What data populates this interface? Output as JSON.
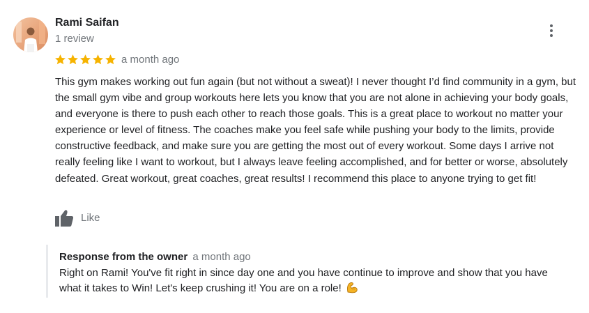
{
  "reviewer": {
    "name": "Rami Saifan",
    "review_count": "1 review",
    "avatar_icon": "profile-photo"
  },
  "review": {
    "rating": 5,
    "rating_max": 5,
    "star_color": "#f6b300",
    "date": "a month ago",
    "text": "This gym makes working out fun again (but not without a sweat)! I never thought I’d find community in a gym, but the small gym vibe and group workouts here lets you know that you are not alone in achieving your body goals, and everyone is there to push each other to reach those goals. This is a great place to workout no matter your experience or level of fitness. The coaches make you feel safe while pushing your body to the limits, provide constructive feedback, and make sure you are getting the most out of every workout. Some days I arrive not really feeling like I want to workout, but I always leave feeling accomplished, and for better or worse, absolutely defeated. Great workout, great coaches, great results! I recommend this place to anyone trying to get fit!"
  },
  "actions": {
    "like_label": "Like",
    "like_icon": "thumbs-up-icon",
    "more_icon": "more-vertical-icon"
  },
  "owner_response": {
    "title": "Response from the owner",
    "date": "a month ago",
    "text": "Right on Rami! You've fit right in since day one and you have continue to improve and show that you have what it takes to Win! Let's keep crushing it! You are on a role!",
    "emoji_icon": "flexed-biceps-icon"
  },
  "colors": {
    "text": "#202124",
    "secondary_text": "#70757a",
    "response_border": "#e8eaed"
  }
}
